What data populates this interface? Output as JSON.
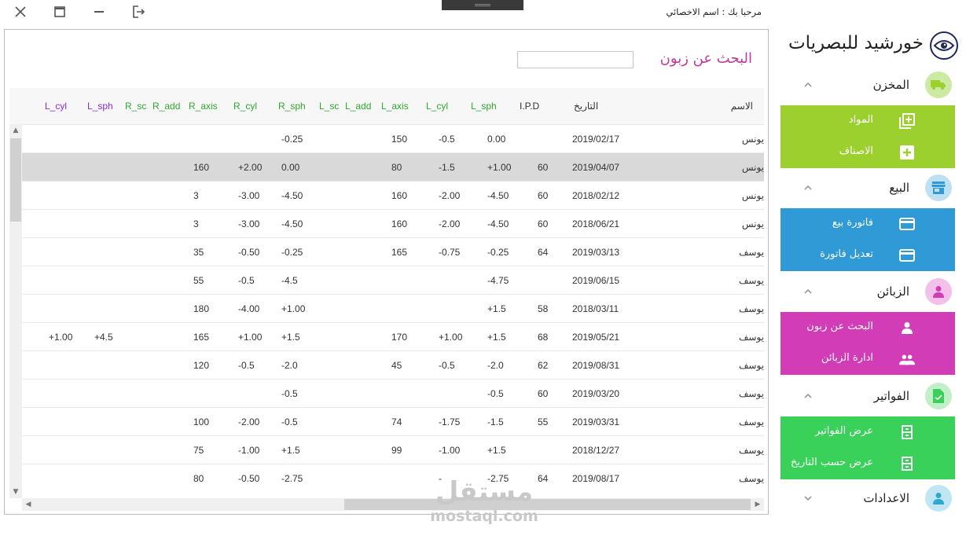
{
  "window": {
    "welcome": "مرحبا بك : اسم الاخصائي"
  },
  "brand": {
    "name": "خورشيد للبصريات"
  },
  "search": {
    "title": "البحث عن زبون",
    "value": ""
  },
  "colors": {
    "warehouse": "#9bd02f",
    "sales": "#2f9ad6",
    "customers": "#d23cb6",
    "invoices": "#39d15a",
    "header_purple": "#8a2be2",
    "header_green": "#2fa82f"
  },
  "sidebar": {
    "warehouse": {
      "label": "المخزن",
      "items": [
        "المواد",
        "الاصناف"
      ]
    },
    "sales": {
      "label": "البيع",
      "items": [
        "فاتورة بيع",
        "تعديل فاتورة"
      ]
    },
    "customers": {
      "label": "الزبائن",
      "items": [
        "البحث عن زبون",
        "ادارة الزبائن"
      ]
    },
    "invoices": {
      "label": "الفواتير",
      "items": [
        "عرض الفواتير",
        "عرض حسب التاريخ"
      ]
    },
    "settings": {
      "label": "الاعدادات"
    }
  },
  "table": {
    "columns": {
      "name": "الاسم",
      "date": "التاريخ",
      "ipd": "I.P.D",
      "l_sph": "L_sph",
      "l_cyl": "L_cyl",
      "l_axis": "L_axis",
      "l_add": "L_add",
      "l_sc": "L_sc",
      "r_sph": "R_sph",
      "r_cyl": "R_cyl",
      "r_axis": "R_axis",
      "r_add": "R_add",
      "r_sc": "R_sc",
      "l_sph2": "L_sph",
      "l_cyl2": "L_cyl"
    },
    "rows": [
      {
        "name": "يونس",
        "date": "2019/02/17",
        "ipd": "",
        "l_sph": "0.00",
        "l_cyl": "-0.5",
        "l_axis": "150",
        "r_sph": "-0.25",
        "r_cyl": "",
        "r_axis": "",
        "l_sph2": "",
        "l_cyl2": ""
      },
      {
        "name": "يونس",
        "date": "2019/04/07",
        "ipd": "60",
        "l_sph": "+1.00",
        "l_cyl": "-1.5",
        "l_axis": "80",
        "r_sph": "0.00",
        "r_cyl": "+2.00",
        "r_axis": "160",
        "l_sph2": "",
        "l_cyl2": ""
      },
      {
        "name": "يونس",
        "date": "2018/02/12",
        "ipd": "60",
        "l_sph": "-4.50",
        "l_cyl": "-2.00",
        "l_axis": "160",
        "r_sph": "-4.50",
        "r_cyl": "-3.00",
        "r_axis": "3",
        "l_sph2": "",
        "l_cyl2": ""
      },
      {
        "name": "يونس",
        "date": "2018/06/21",
        "ipd": "60",
        "l_sph": "-4.50",
        "l_cyl": "-2.00",
        "l_axis": "160",
        "r_sph": "-4.50",
        "r_cyl": "-3.00",
        "r_axis": "3",
        "l_sph2": "",
        "l_cyl2": ""
      },
      {
        "name": "يوسف",
        "date": "2019/03/13",
        "ipd": "64",
        "l_sph": "-0.25",
        "l_cyl": "-0.75",
        "l_axis": "165",
        "r_sph": "-0.25",
        "r_cyl": "-0.50",
        "r_axis": "35",
        "l_sph2": "",
        "l_cyl2": ""
      },
      {
        "name": "يوسف",
        "date": "2019/06/15",
        "ipd": "",
        "l_sph": "-4.75",
        "l_cyl": "",
        "l_axis": "",
        "r_sph": "-4.5",
        "r_cyl": "-0.5",
        "r_axis": "55",
        "l_sph2": "",
        "l_cyl2": ""
      },
      {
        "name": "يوسف",
        "date": "2018/03/11",
        "ipd": "58",
        "l_sph": "+1.5",
        "l_cyl": "",
        "l_axis": "",
        "r_sph": "+1.00",
        "r_cyl": "-4.00",
        "r_axis": "180",
        "l_sph2": "",
        "l_cyl2": ""
      },
      {
        "name": "يوسف",
        "date": "2019/05/21",
        "ipd": "68",
        "l_sph": "+1.5",
        "l_cyl": "+1.00",
        "l_axis": "170",
        "r_sph": "+1.5",
        "r_cyl": "+1.00",
        "r_axis": "165",
        "l_sph2": "+4.5",
        "l_cyl2": "+1.00"
      },
      {
        "name": "يوسف",
        "date": "2019/08/31",
        "ipd": "62",
        "l_sph": "-2.0",
        "l_cyl": "-0.5",
        "l_axis": "45",
        "r_sph": "-2.0",
        "r_cyl": "-0.5",
        "r_axis": "120",
        "l_sph2": "",
        "l_cyl2": ""
      },
      {
        "name": "يوسف",
        "date": "2019/03/20",
        "ipd": "60",
        "l_sph": "-0.5",
        "l_cyl": "",
        "l_axis": "",
        "r_sph": "-0.5",
        "r_cyl": "",
        "r_axis": "",
        "l_sph2": "",
        "l_cyl2": ""
      },
      {
        "name": "يوسف",
        "date": "2019/03/31",
        "ipd": "55",
        "l_sph": "-1.5",
        "l_cyl": "-1.75",
        "l_axis": "74",
        "r_sph": "-0.5",
        "r_cyl": "-2.00",
        "r_axis": "100",
        "l_sph2": "",
        "l_cyl2": ""
      },
      {
        "name": "يوسف",
        "date": "2018/12/27",
        "ipd": "",
        "l_sph": "+1.5",
        "l_cyl": "-1.00",
        "l_axis": "99",
        "r_sph": "+1.5",
        "r_cyl": "-1.00",
        "r_axis": "75",
        "l_sph2": "",
        "l_cyl2": ""
      },
      {
        "name": "يوسف",
        "date": "2019/08/17",
        "ipd": "64",
        "l_sph": "-2.75",
        "l_cyl": "-",
        "l_axis": "",
        "r_sph": "-2.75",
        "r_cyl": "-0.50",
        "r_axis": "80",
        "l_sph2": "",
        "l_cyl2": ""
      }
    ]
  },
  "watermark": {
    "ar": "مستقل",
    "en": "mostaql.com"
  }
}
